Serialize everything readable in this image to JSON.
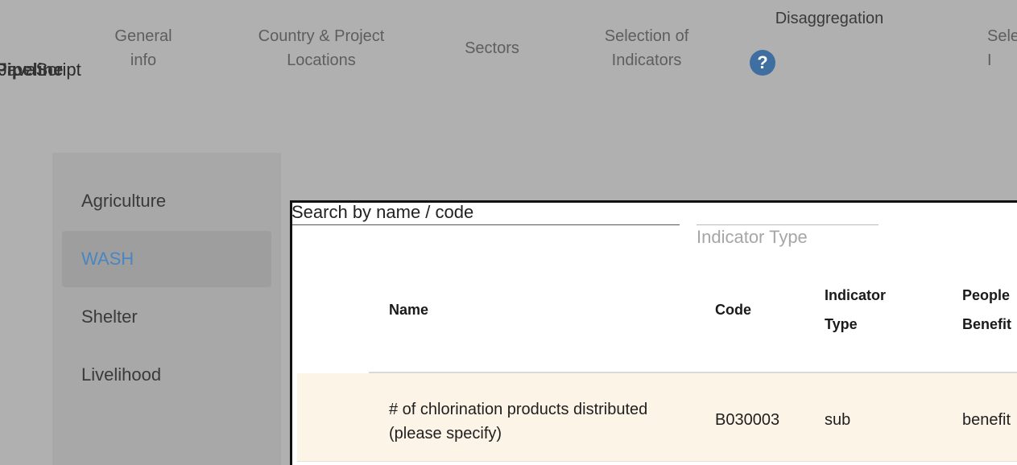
{
  "broken_labels": {
    "primary": "JavaScript",
    "overlay": "Pipeline"
  },
  "steps": [
    {
      "label_line1": "General",
      "label_line2": "info"
    },
    {
      "label_line1": "Country & Project",
      "label_line2": "Locations"
    },
    {
      "label": "Sectors"
    },
    {
      "label_line1": "Selection of",
      "label_line2": "Indicators"
    },
    {
      "label": "Disaggregation"
    },
    {
      "label_line1": "Sele",
      "label_line2": "I"
    }
  ],
  "help": {
    "glyph": "?",
    "icon": "question-circle-icon",
    "color": "#3f6fa0"
  },
  "sectors": [
    {
      "label": "Agriculture",
      "active": false
    },
    {
      "label": "WASH",
      "active": true
    },
    {
      "label": "Shelter",
      "active": false
    },
    {
      "label": "Livelihood",
      "active": false
    }
  ],
  "modal": {
    "search_placeholder": "Search by name / code",
    "type_select_label": "Indicator Type",
    "headers": {
      "name": "Name",
      "code": "Code",
      "type_line1": "Indicator",
      "type_line2": "Type",
      "people_line1": "People",
      "people_line2": "Benefit"
    },
    "rows": [
      {
        "name": "# of chlorination products distributed (please specify)",
        "code": "B030003",
        "type": "sub",
        "people": "benefit"
      }
    ]
  },
  "colors": {
    "overlay_bg": "#b0b0b0",
    "active_sector": "#4a86c0",
    "row_highlight": "#fdf4e8"
  }
}
